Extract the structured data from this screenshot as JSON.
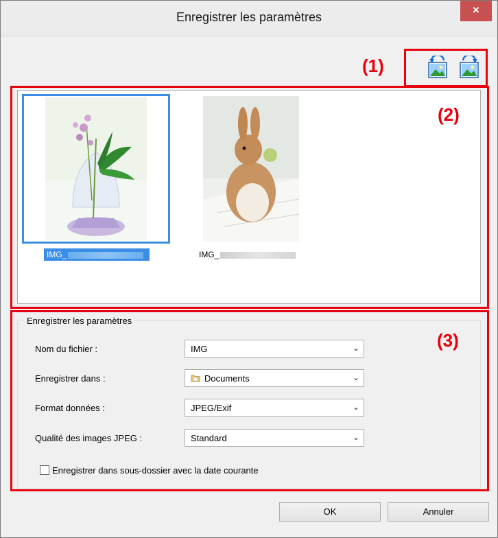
{
  "window": {
    "title": "Enregistrer les paramètres",
    "close_glyph": "×"
  },
  "annotations": {
    "toolbar": "(1)",
    "preview": "(2)",
    "settings": "(3)"
  },
  "toolbar": {
    "icons": [
      "rotate-left-icon",
      "rotate-right-icon"
    ]
  },
  "thumbnails": [
    {
      "label": "IMG_",
      "selected": true,
      "subject": "flower-image"
    },
    {
      "label": "IMG_",
      "selected": false,
      "subject": "rabbit-image"
    }
  ],
  "settings": {
    "group_title": "Enregistrer les paramètres",
    "file_name": {
      "label": "Nom du fichier :",
      "value": "IMG"
    },
    "save_in": {
      "label": "Enregistrer dans :",
      "value": "Documents",
      "icon": "folder-icon"
    },
    "data_format": {
      "label": "Format données :",
      "value": "JPEG/Exif"
    },
    "jpeg_quality": {
      "label": "Qualité des images JPEG :",
      "value": "Standard"
    },
    "subfolder_checkbox": {
      "label": "Enregistrer dans sous-dossier avec la date courante",
      "checked": false
    }
  },
  "buttons": {
    "ok": "OK",
    "cancel": "Annuler"
  },
  "colors": {
    "annotation_red": "#e8000d",
    "selection_blue": "#3a8ee6",
    "close_red": "#c75050"
  }
}
